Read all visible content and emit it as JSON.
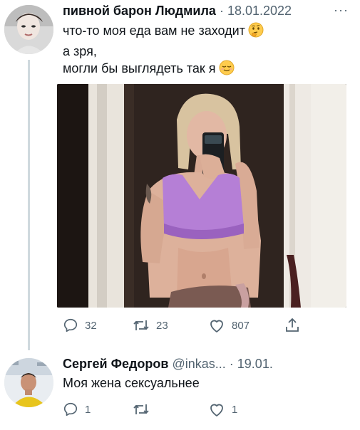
{
  "tweet": {
    "author_name": "пивной барон Людмила",
    "separator": "·",
    "date": "18.01.2022",
    "more": "···",
    "lines": [
      "что-то моя еда вам не заходит",
      "а зря,",
      "могли бы выглядеть так я"
    ],
    "emoji": [
      "thinking-face-emoji",
      "relieved-face-emoji"
    ],
    "stats": {
      "replies": "32",
      "retweets": "23",
      "likes": "807"
    }
  },
  "reply": {
    "author_name": "Сергей Федоров",
    "handle": "@inkas...",
    "separator": "·",
    "date": "19.01.",
    "text": "Моя жена сексуальнее",
    "stats": {
      "replies": "1",
      "retweets": "",
      "likes": "1"
    }
  },
  "icons": {
    "reply": "reply-icon",
    "retweet": "retweet-icon",
    "like": "heart-icon",
    "share": "share-icon"
  },
  "colors": {
    "text": "#0f1419",
    "secondary": "#536471",
    "thread_line": "#cfd9de"
  }
}
